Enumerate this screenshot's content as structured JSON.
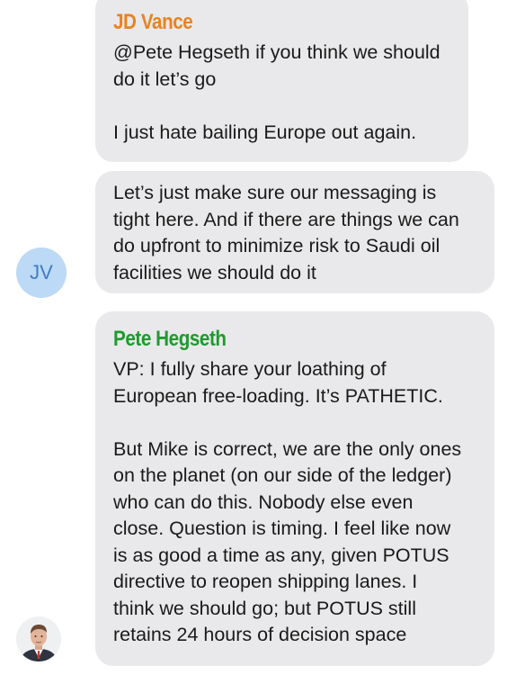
{
  "messages": [
    {
      "sender": "JD Vance",
      "sender_color": "#e8831f",
      "lines": [
        "@Pete Hegseth if you think we should",
        "do it let’s go",
        "",
        "I just hate bailing Europe out again."
      ]
    },
    {
      "sender": "",
      "lines": [
        "Let’s just make sure our messaging is",
        "tight here. And if there are things we can",
        "do upfront to minimize risk to Saudi oil",
        "facilities we should do it"
      ]
    },
    {
      "sender": "Pete Hegseth",
      "sender_color": "#1f9a2e",
      "lines": [
        "VP: I fully share your loathing of",
        "European free-loading. It’s PATHETIC.",
        "",
        "But Mike is correct, we are the only ones",
        "on the planet (on our side of the ledger)",
        "who can do this.  Nobody else even",
        "close.  Question is timing. I feel like now",
        "is as good a time as any, given POTUS",
        "directive to reopen shipping lanes. I",
        "think we should go; but POTUS still",
        "retains 24 hours of decision space"
      ]
    }
  ],
  "avatars": {
    "jv_initials": "JV",
    "pete": "person-photo-icon"
  },
  "colors": {
    "bubble_bg": "#e9e9eb",
    "jv_avatar_bg": "#bcd9f6",
    "jv_avatar_text": "#3f7cc4"
  }
}
